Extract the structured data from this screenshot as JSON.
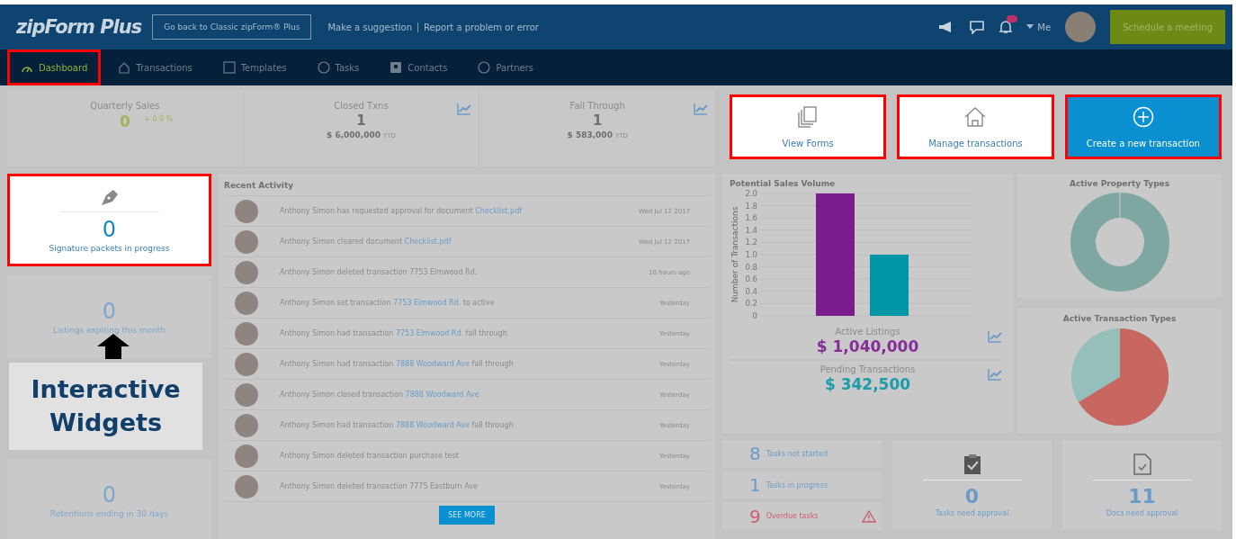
{
  "header": {
    "logo": "zipForm Plus",
    "back_button": "Go back to Classic zipForm® Plus",
    "links": [
      "Make a suggestion",
      "Report a problem or error"
    ],
    "user": "Me",
    "schedule_button": "Schedule a meeting"
  },
  "nav": [
    {
      "label": "Dashboard",
      "selected": true,
      "highlighted": true
    },
    {
      "label": "Transactions",
      "selected": false,
      "highlighted": false
    },
    {
      "label": "Templates",
      "selected": false,
      "highlighted": false
    },
    {
      "label": "Tasks",
      "selected": false,
      "highlighted": false
    },
    {
      "label": "Contacts",
      "selected": false,
      "highlighted": false
    },
    {
      "label": "Partners",
      "selected": false,
      "highlighted": false
    }
  ],
  "stats": [
    {
      "kind": "change",
      "title": "Quarterly Sales",
      "value": "0",
      "change": "+ 0.0 %"
    },
    {
      "kind": "total",
      "title": "Closed Txns",
      "value": "1",
      "amount": "$ 6,000,000",
      "suffix": "YTD"
    },
    {
      "kind": "total",
      "title": "Fall Through",
      "value": "1",
      "amount": "$ 583,000",
      "suffix": "YTD"
    }
  ],
  "actions": [
    {
      "label": "View Forms",
      "kind": "forms",
      "highlighted": true
    },
    {
      "label": "Manage transactions",
      "kind": "house",
      "highlighted": true
    },
    {
      "label": "Create a new transaction",
      "kind": "create",
      "highlighted": true
    }
  ],
  "widgets": [
    {
      "kind": "pen",
      "value": "0",
      "label": "Signature packets in progress",
      "highlighted": true
    },
    {
      "kind": "plain",
      "value": "0",
      "label": "Listings expiring this month",
      "highlighted": false
    },
    {
      "kind": "hidden",
      "highlighted": false
    },
    {
      "kind": "plain",
      "value": "0",
      "label": "Retentions ending in 30 days",
      "highlighted": false
    }
  ],
  "annotation": {
    "label": "Interactive Widgets"
  },
  "recent_activity": {
    "title": "Recent Activity",
    "rows": [
      {
        "text": "Anthony Simon has requested approval for document ",
        "link": "Checklist.pdf",
        "time": "Wed Jul 12 2017"
      },
      {
        "text": "Anthony Simon cleared document ",
        "link": "Checklist.pdf",
        "time": "Wed Jul 12 2017"
      },
      {
        "text": "Anthony Simon deleted transaction 7753 Elmwood Rd.",
        "time": "10 hours ago"
      },
      {
        "text": "Anthony Simon set transaction ",
        "link": "7753 Elmwood Rd.",
        "after": " to active",
        "time": "Yesterday"
      },
      {
        "text": "Anthony Simon had transaction ",
        "link": "7753 Elmwood Rd.",
        "after": " fall through",
        "time": "Yesterday"
      },
      {
        "text": "Anthony Simon had transaction ",
        "link": "7888 Woodward Ave",
        "after": " fall through",
        "time": "Yesterday"
      },
      {
        "text": "Anthony Simon closed transaction ",
        "link": "7888 Woodward Ave",
        "time": "Yesterday"
      },
      {
        "text": "Anthony Simon had transaction ",
        "link": "7888 Woodward Ave",
        "after": " fall through",
        "time": "Yesterday"
      },
      {
        "text": "Anthony Simon deleted transaction purchase test",
        "time": "Yesterday"
      },
      {
        "text": "Anthony Simon deleted transaction 7775 Eastburn Ave",
        "time": "Yesterday"
      }
    ],
    "see_more": "SEE MORE"
  },
  "sales": {
    "title": "Potential Sales Volume",
    "chart_data": {
      "type": "bar",
      "ylabel": "Number of Transactions",
      "values": [
        2,
        1
      ],
      "colors": [
        "#7b1c8c",
        "#0196a6"
      ],
      "ylim": [
        0,
        2
      ],
      "grid": true,
      "yticks": [
        0,
        0.2,
        0.4,
        0.6,
        0.8,
        {
          "value": 1,
          "label": "1.0"
        },
        1.2,
        1.4,
        1.6,
        1.8,
        {
          "value": 2,
          "label": "2.0"
        }
      ]
    },
    "figures": [
      {
        "label": "Active Listings",
        "value": "$ 1,040,000",
        "color": "#862e98"
      },
      {
        "label": "Pending Transactions",
        "value": "$ 342,500",
        "color": "#1a9cab"
      }
    ]
  },
  "property_types": {
    "title": "Active Property Types"
  },
  "transaction_types": {
    "title": "Active Transaction Types"
  },
  "tasks": [
    {
      "value": "8",
      "label": "Tasks not started",
      "kind": "normal"
    },
    {
      "value": "1",
      "label": "Tasks in progress",
      "kind": "normal"
    },
    {
      "value": "9",
      "label": "Overdue tasks",
      "kind": "overdue"
    }
  ],
  "approvals": [
    {
      "kind": "clipboard",
      "value": "0",
      "label": "Tasks need approval"
    },
    {
      "kind": "document",
      "value": "11",
      "label": "Docs need approval"
    }
  ]
}
